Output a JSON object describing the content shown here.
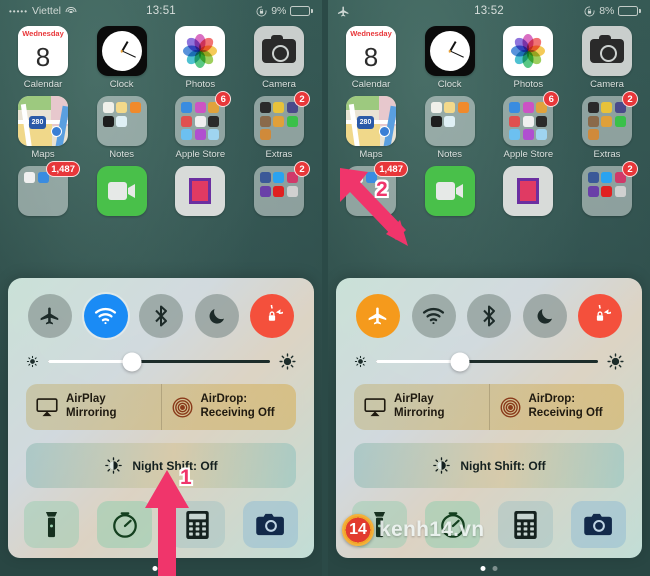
{
  "panels": [
    {
      "id": "before",
      "status_bar": {
        "signal_dots": "•••••",
        "carrier": "Viettel",
        "wifi_icon": "wifi-icon",
        "airplane_icon": null,
        "time": "13:51",
        "rotation_lock_icon": "rotation-lock-icon",
        "battery_percent": "9%",
        "battery_level": 9
      },
      "control_center": {
        "toggles": [
          {
            "name": "airplane-mode-toggle",
            "label": "Airplane Mode",
            "state": "off"
          },
          {
            "name": "wifi-toggle",
            "label": "Wi-Fi",
            "state": "on-blue"
          },
          {
            "name": "bluetooth-toggle",
            "label": "Bluetooth",
            "state": "off"
          },
          {
            "name": "do-not-disturb-toggle",
            "label": "Do Not Disturb",
            "state": "off"
          },
          {
            "name": "rotation-lock-toggle",
            "label": "Portrait Orientation Lock",
            "state": "on-red"
          }
        ],
        "brightness": {
          "label": "Brightness",
          "value": 38
        },
        "airplay_label": "AirPlay\nMirroring",
        "airplay_line1": "AirPlay",
        "airplay_line2": "Mirroring",
        "airdrop_line1": "AirDrop:",
        "airdrop_line2": "Receiving Off",
        "night_shift_label": "Night Shift: Off",
        "shortcuts": [
          {
            "name": "flashlight-button",
            "label": "Flashlight"
          },
          {
            "name": "timer-button",
            "label": "Timer"
          },
          {
            "name": "calculator-button",
            "label": "Calculator"
          },
          {
            "name": "camera-button",
            "label": "Camera"
          }
        ]
      }
    },
    {
      "id": "after",
      "status_bar": {
        "signal_dots": "",
        "carrier": "",
        "wifi_icon": null,
        "airplane_icon": "airplane-icon",
        "time": "13:52",
        "rotation_lock_icon": "rotation-lock-icon",
        "battery_percent": "8%",
        "battery_level": 8
      },
      "control_center": {
        "toggles": [
          {
            "name": "airplane-mode-toggle",
            "label": "Airplane Mode",
            "state": "on-orange"
          },
          {
            "name": "wifi-toggle",
            "label": "Wi-Fi",
            "state": "off"
          },
          {
            "name": "bluetooth-toggle",
            "label": "Bluetooth",
            "state": "off"
          },
          {
            "name": "do-not-disturb-toggle",
            "label": "Do Not Disturb",
            "state": "off"
          },
          {
            "name": "rotation-lock-toggle",
            "label": "Portrait Orientation Lock",
            "state": "on-red"
          }
        ],
        "brightness": {
          "label": "Brightness",
          "value": 38
        },
        "airplay_line1": "AirPlay",
        "airplay_line2": "Mirroring",
        "airdrop_line1": "AirDrop:",
        "airdrop_line2": "Receiving Off",
        "night_shift_label": "Night Shift: Off",
        "shortcuts": [
          {
            "name": "flashlight-button",
            "label": "Flashlight"
          },
          {
            "name": "timer-button",
            "label": "Timer"
          },
          {
            "name": "calculator-button",
            "label": "Calculator"
          },
          {
            "name": "camera-button",
            "label": "Camera"
          }
        ]
      }
    }
  ],
  "home_screen": {
    "row1": [
      {
        "name": "calendar-app",
        "label": "Calendar",
        "weekday": "Wednesday",
        "day": "8",
        "badge": null
      },
      {
        "name": "clock-app",
        "label": "Clock",
        "badge": null
      },
      {
        "name": "photos-app",
        "label": "Photos",
        "badge": null
      },
      {
        "name": "camera-app",
        "label": "Camera",
        "badge": null
      }
    ],
    "row2": [
      {
        "name": "maps-app",
        "label": "Maps",
        "route": "280",
        "badge": null
      },
      {
        "name": "notes-folder",
        "label": "Notes",
        "badge": null
      },
      {
        "name": "apple-store-folder",
        "label": "Apple Store",
        "badge": "6"
      },
      {
        "name": "extras-folder",
        "label": "Extras",
        "badge": "2"
      }
    ],
    "row3": [
      {
        "name": "mail-folder",
        "label": "",
        "badge": "1,487"
      },
      {
        "name": "facetime-app",
        "label": "",
        "badge": null
      },
      {
        "name": "books-app",
        "label": "",
        "badge": null
      },
      {
        "name": "social-folder",
        "label": "",
        "badge": "2"
      }
    ],
    "page_dots": {
      "count": 2,
      "active": 0
    }
  },
  "annotations": [
    {
      "name": "annotation-arrow-1",
      "number": "1",
      "color": "#f0356b",
      "direction": "up",
      "target": "swipe-up-from-bottom"
    },
    {
      "name": "annotation-arrow-2",
      "number": "2",
      "color": "#f0356b",
      "direction": "down-right",
      "target": "airplane-mode-toggle"
    }
  ],
  "watermark": {
    "name": "kenh14-watermark",
    "logo_text": "14",
    "text": "kenh14.vn"
  }
}
